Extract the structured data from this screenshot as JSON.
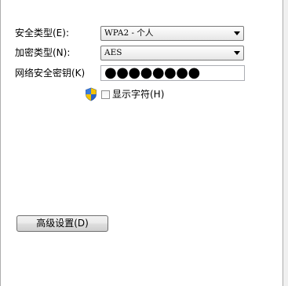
{
  "security_type": {
    "label": "安全类型(E):",
    "value": "WPA2 - 个人"
  },
  "encryption_type": {
    "label": "加密类型(N):",
    "value": "AES"
  },
  "network_key": {
    "label": "网络安全密钥(K)",
    "value": "●●●●●●●●"
  },
  "show_characters": {
    "label": "显示字符(H)",
    "checked": false,
    "icon": "uac-shield-icon"
  },
  "advanced_button": {
    "label": "高级设置(D)"
  }
}
